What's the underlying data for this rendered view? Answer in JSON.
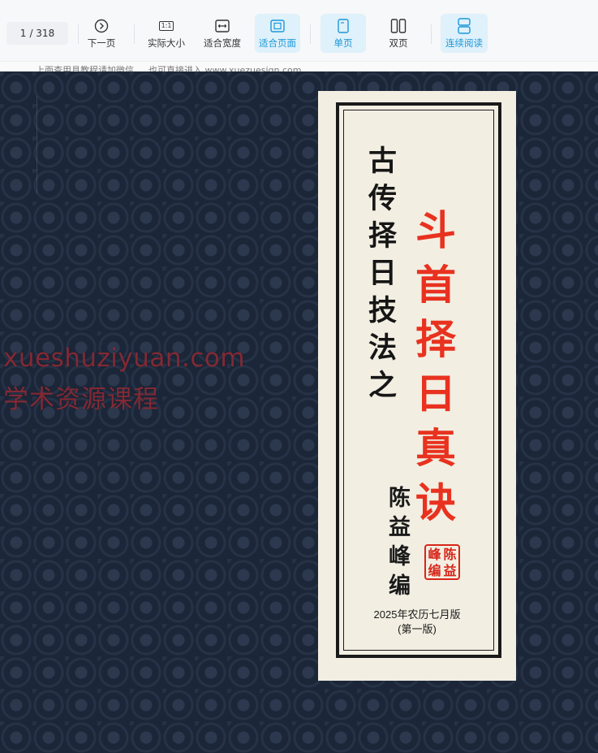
{
  "toolbar": {
    "page_current": "1",
    "page_total": "/ 318",
    "buttons": {
      "next": "下一页",
      "actual_size": "实际大小",
      "fit_width": "适合宽度",
      "fit_page": "适合页面",
      "single_page": "单页",
      "double_page": "双页",
      "continuous": "连续阅读"
    },
    "actual_size_icon_text": "1:1",
    "accent_color": "#1c98d8"
  },
  "notice_strip": {
    "text": "上面查用具教程请加微信 … 也可直接进入 www.xuezuesiqn.com"
  },
  "watermark": {
    "line1": "xueshuziyuan.com",
    "line2": "学术资源课程"
  },
  "cover": {
    "subtitle_chars": [
      "古",
      "传",
      "择",
      "日",
      "技",
      "法",
      "之"
    ],
    "title_chars": [
      "斗",
      "首",
      "择",
      "日",
      "真",
      "诀"
    ],
    "author_chars": [
      "陈",
      "益",
      "峰",
      "编"
    ],
    "seal_chars": [
      "陈",
      "益",
      "峰",
      "编"
    ],
    "edition_line1": "2025年农历七月版",
    "edition_line2": "(第一版)",
    "title_color": "#e8321f",
    "background_color": "#1b2638",
    "label_color": "#f2eee2"
  }
}
